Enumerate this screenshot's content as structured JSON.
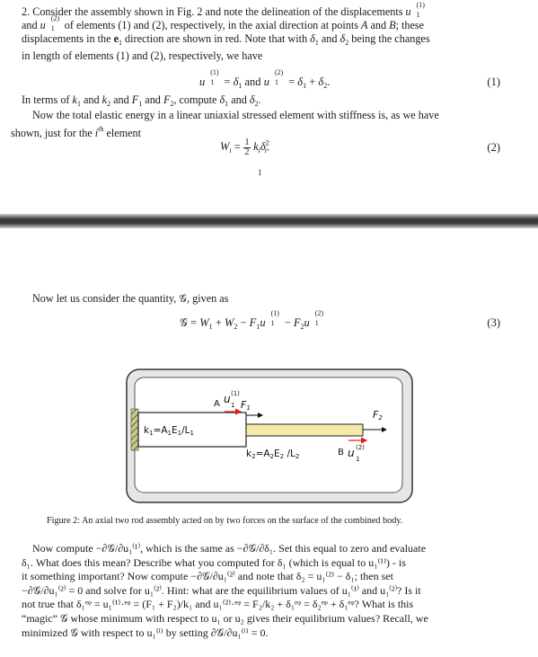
{
  "page1": {
    "paragraph_intro": "2. Consider the assembly shown in Fig. 2 and note the delineation of the displacements u1(1) and u1(2) of elements (1) and (2), respectively, in the axial direction at points A and B; these displacements in the e1 direction are shown in red. Note that with δ1 and δ2 being the changes in length of elements (1) and (2), respectively, we have",
    "line1": "2. Consider the assembly shown in Fig. 2 and note the delineation of the displacements",
    "line2a": "and",
    "line2b": "of elements (1) and (2), respectively, in the axial direction at points",
    "line2c": "and",
    "line2d": "; these",
    "line3": "displacements in the",
    "line3b": "direction are shown in red. Note that with",
    "line3c": "and",
    "line3d": "being the changes",
    "line4": "in length of elements (1) and (2), respectively, we have",
    "eq1_number": "(1)",
    "paragraph_compute": "In terms of k1 and k2 and F1 and F2, compute δ1 and δ2.",
    "compute_a": "In terms of",
    "compute_b": "and",
    "compute_c": "and",
    "compute_d": "and",
    "compute_e": ", compute",
    "compute_f": "and",
    "paragraph_energy_1": "Now the total elastic energy in a linear uniaxial stressed element with stiffness is, as we have",
    "paragraph_energy_2a": "shown, just for the",
    "paragraph_energy_2b": "element",
    "eq2_number": "(2)",
    "page_number": "1"
  },
  "page2": {
    "paragraph_quantity": "Now let us consider the quantity, 𝒢, given as",
    "eq3_number": "(3)",
    "figure": {
      "label_A": "A",
      "label_B": "B",
      "label_u1_top": "u",
      "label_u1_top_sup": "(1)",
      "label_u1_top_sub": "1",
      "label_F1": "F",
      "label_F1_sub": "1",
      "label_F2": "F",
      "label_F2_sub": "2",
      "label_element1": "k1 = A1E1/L1",
      "label_element2": "k2 = A2E2/L2",
      "label_u1_bottom_sup": "(2)",
      "label_u1_bottom_sub": "1",
      "colors": {
        "element1_fill": "#ffffff",
        "element2_fill": "#f5e8a8",
        "arrow_red": "#e02020",
        "frame_fill": "#e6e6e6",
        "inner_fill": "#ffffff"
      }
    },
    "caption": "Figure 2: An axial two rod assembly acted on by two forces on the surface of the combined body.",
    "final_paragraph_lines": [
      "Now compute −∂𝒢/∂u₁⁽¹⁾, which is the same as −∂𝒢/∂δ₁. Set this equal to zero and evaluate",
      "δ₁. What does this mean? Describe what you computed for δ₁ (which is equal to u₁⁽¹⁾) - is",
      "it something important? Now compute −∂𝒢/∂u₁⁽²⁾ and note that δ₂ = u₁⁽²⁾ − δ₁; then set",
      "−∂𝒢/∂u₁⁽²⁾ = 0 and solve for u₁⁽²⁾. Hint: what are the equilibrium values of u₁⁽¹⁾ and u₁⁽²⁾? Is it",
      "not true that δ₁ᵉᵠ = u₁⁽¹⁾·ᵉᵠ = (F₁ + F₂)/k₁ and u₁⁽²⁾·ᵉᵠ = F₂/k₂ + δ₁ᵉᵠ = δ₂ᵉᵠ + δ₁ᵉᵠ? What is this",
      "“magic” 𝒢 whose minimum with respect to u₁ or u₂ gives their equilibrium values? Recall, we",
      "minimized 𝒢 with respect to u₁⁽ⁱ⁾ by setting ∂𝒢/∂u₁⁽ⁱ⁾ = 0."
    ]
  }
}
